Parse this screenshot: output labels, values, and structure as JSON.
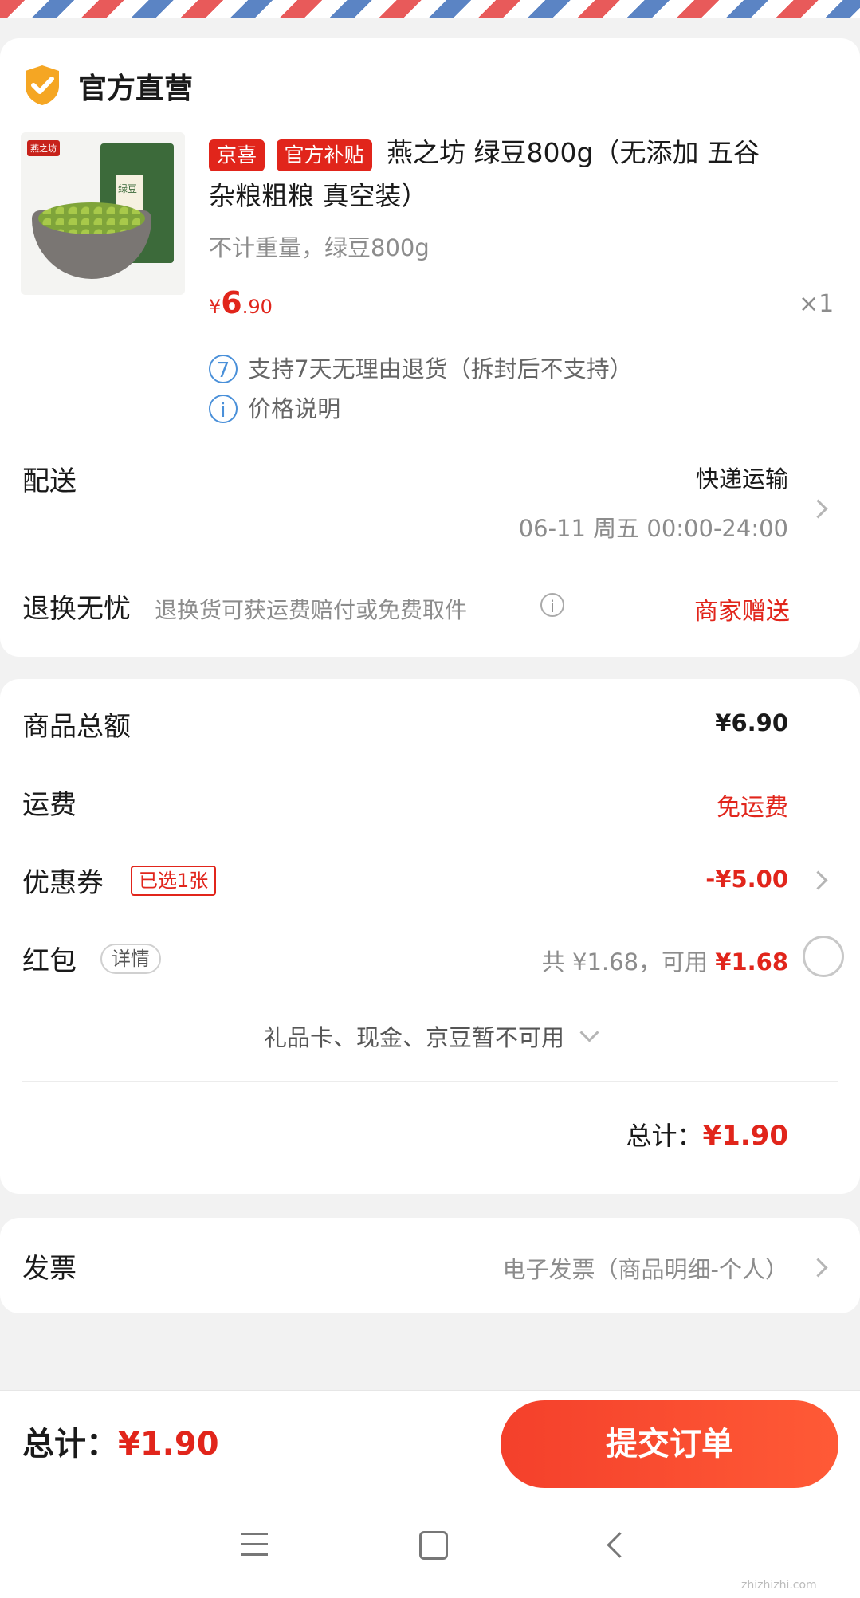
{
  "store": {
    "name": "官方直营",
    "badge_color": "#f5a623"
  },
  "product": {
    "image_brand": "燕之坊",
    "image_label": "绿豆",
    "tag_jingxi": "京喜",
    "tag_subsidy": "官方补贴",
    "title_line1": "燕之坊 绿豆800g（无添加 五谷",
    "title_line2": "杂粮粗粮 真空装）",
    "spec": "不计重量，绿豆800g",
    "price_symbol": "¥",
    "price_int": "6",
    "price_dec": ".90",
    "quantity": "×1",
    "return_badge": "7",
    "return_policy": "支持7天无理由退货（拆封后不支持）",
    "price_note": "价格说明"
  },
  "delivery": {
    "label": "配送",
    "method": "快递运输",
    "time": "06-11 周五 00:00-24:00"
  },
  "return_insurance": {
    "label": "退换无忧",
    "desc": "退换货可获运费赔付或免费取件",
    "value": "商家赠送"
  },
  "summary": {
    "goods_total_label": "商品总额",
    "goods_total_value": "¥6.90",
    "shipping_label": "运费",
    "shipping_value": "免运费",
    "coupon_label": "优惠券",
    "coupon_badge": "已选1张",
    "coupon_value": "-¥5.00",
    "redpacket_label": "红包",
    "redpacket_detail": "详情",
    "redpacket_total": "共 ¥1.68，可用 ",
    "redpacket_available": "¥1.68",
    "unavailable": "礼品卡、现金、京豆暂不可用",
    "total_label": "总计：",
    "total_value": "¥1.90"
  },
  "invoice": {
    "label": "发票",
    "value": "电子发票（商品明细-个人）"
  },
  "bottom_bar": {
    "total_label": "总计：",
    "total_value": "¥1.90",
    "submit": "提交订单"
  },
  "watermark": "zhizhizhi.com",
  "colors": {
    "accent": "#e1251b",
    "button": "#f4402b"
  }
}
